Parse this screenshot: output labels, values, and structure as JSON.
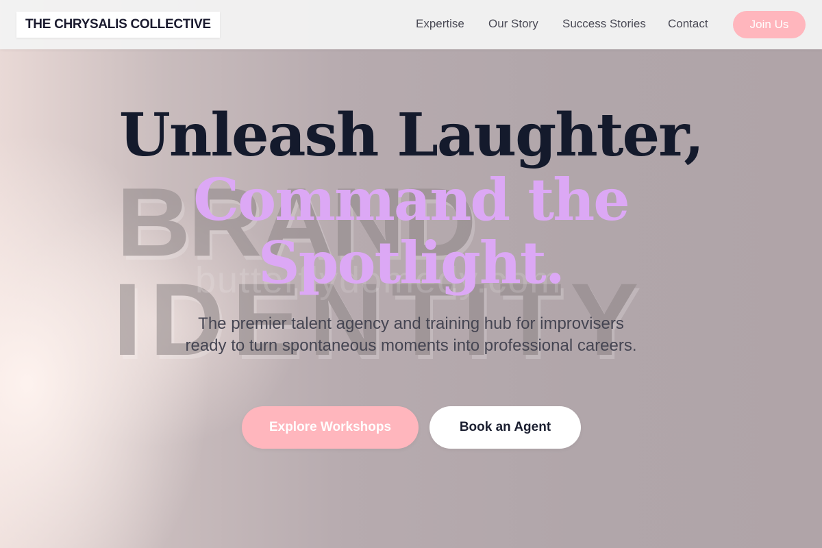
{
  "brand": {
    "name": "THE CHRYSALIS COLLECTIVE"
  },
  "nav": {
    "items": [
      {
        "label": "Expertise"
      },
      {
        "label": "Our Story"
      },
      {
        "label": "Success Stories"
      },
      {
        "label": "Contact"
      }
    ],
    "cta_label": "Join Us"
  },
  "hero": {
    "headline": "Unleash Laughter,",
    "headline_accent_line1": "Command the",
    "headline_accent_line2": "Spotlight.",
    "subtitle": "The premier talent agency and training hub for improvisers ready to turn spontaneous moments into professional careers.",
    "primary_button": "Explore Workshops",
    "secondary_button": "Book an Agent",
    "background_words": [
      "BRAND",
      "IDENTITY"
    ],
    "watermark": "butterflydomedy.com"
  },
  "colors": {
    "accent_pink": "#ffb6bd",
    "accent_lavender": "#dca8f5",
    "ink": "#141a2c"
  }
}
